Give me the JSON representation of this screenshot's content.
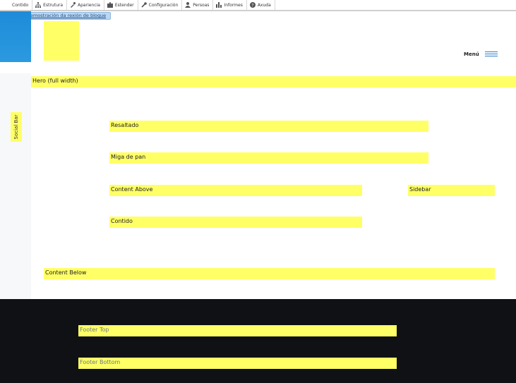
{
  "toolbar": {
    "items": [
      {
        "label": "Contido",
        "icon": "menu-icon"
      },
      {
        "label": "Estrutura",
        "icon": "sitemap-icon"
      },
      {
        "label": "Apariencia",
        "icon": "brush-icon"
      },
      {
        "label": "Estender",
        "icon": "puzzle-icon"
      },
      {
        "label": "Configuración",
        "icon": "wrench-icon"
      },
      {
        "label": "Persoas",
        "icon": "person-icon"
      },
      {
        "label": "Informes",
        "icon": "bar-chart-icon"
      },
      {
        "label": "Axuda",
        "icon": "help-icon"
      }
    ]
  },
  "demo": {
    "label": "Saír da demostración da rexión de bloque"
  },
  "header": {
    "menu_label": "Menú"
  },
  "social": {
    "label": "Social Bar"
  },
  "regions": {
    "hero": "Hero (full width)",
    "highlighted": "Resaltado",
    "breadcrumb": "Miga de pan",
    "content_above": "Content Above",
    "sidebar": "Sidebar",
    "content": "Contido",
    "content_below": "Content Below",
    "footer_top": "Footer Top",
    "footer_bottom": "Footer Bottom"
  },
  "colors": {
    "region": "#ffff66",
    "accent_blue": "#1e8bd8",
    "footer_bg": "#0f1114"
  }
}
